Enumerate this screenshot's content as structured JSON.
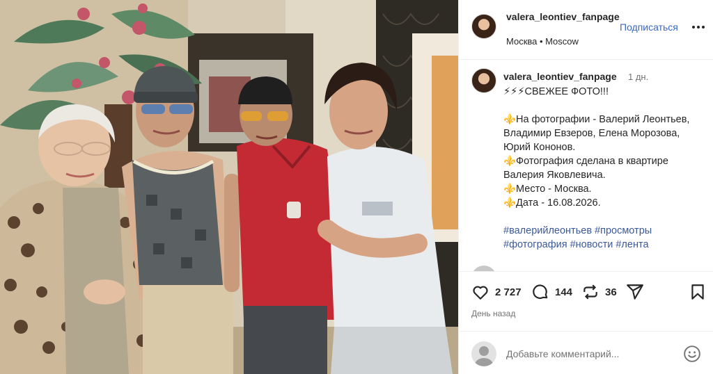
{
  "post": {
    "username": "valera_leontiev_fanpage",
    "location": "Москва • Moscow",
    "follow_label": "Подписаться"
  },
  "caption": {
    "username": "valera_leontiev_fanpage",
    "time": "1 дн.",
    "lines": [
      "⚡⚡⚡СВЕЖЕЕ ФОТО!!!",
      "",
      "⚜️На фотографии - Валерий Леонтьев, Владимир Евзеров, Елена Морозова, Юрий Кононов.",
      "⚜️Фотография сделана в квартире Валерия Яковлевича.",
      "⚜️Место - Москва.",
      "⚜️Дата - 16.08.2026."
    ],
    "hashtags": "#валерийлеонтьев #просмотры #фотография #новости #лента"
  },
  "actions": {
    "likes": "2 727",
    "comments": "144",
    "reposts": "36",
    "when": "День назад"
  },
  "comment_box": {
    "placeholder": "Добавьте комментарий..."
  },
  "icons": {
    "like": "heart-icon",
    "comment": "comment-icon",
    "repost": "repost-icon",
    "share": "share-icon",
    "save": "bookmark-icon",
    "more": "more-icon",
    "emoji": "emoji-icon"
  },
  "colors": {
    "link": "#3b67c4",
    "hashtag": "#3b5998",
    "muted": "#737373",
    "text": "#262626"
  }
}
